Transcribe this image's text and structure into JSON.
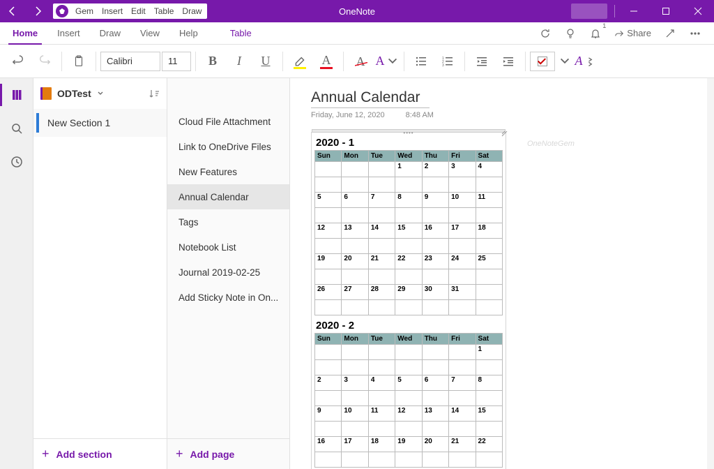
{
  "title": "OneNote",
  "quick_access": {
    "items": [
      "Gem",
      "Insert",
      "Edit",
      "Table",
      "Draw"
    ]
  },
  "ribbon": {
    "tabs": [
      "Home",
      "Insert",
      "Draw",
      "View",
      "Help",
      "Table"
    ],
    "active_tab": "Home",
    "font_name": "Calibri",
    "font_size": "11",
    "share_label": "Share",
    "notification_count": "1"
  },
  "notebook": {
    "name": "ODTest",
    "sections": [
      "New Section 1"
    ],
    "active_section": "New Section 1",
    "add_section_label": "Add section"
  },
  "pages": {
    "items": [
      "Cloud File Attachment",
      "Link to OneDrive Files",
      "New Features",
      "Annual Calendar",
      "Tags",
      "Notebook List",
      "Journal 2019-02-25",
      "Add Sticky Note in On..."
    ],
    "active_index": 3,
    "add_page_label": "Add page"
  },
  "page": {
    "title": "Annual Calendar",
    "date": "Friday, June 12, 2020",
    "time": "8:48 AM"
  },
  "watermark": "OneNoteGem",
  "calendar": {
    "day_headers": [
      "Sun",
      "Mon",
      "Tue",
      "Wed",
      "Thu",
      "Fri",
      "Sat"
    ],
    "months": [
      {
        "label": "2020 - 1",
        "weeks": [
          [
            "",
            "",
            "",
            "1",
            "2",
            "3",
            "4"
          ],
          [
            "5",
            "6",
            "7",
            "8",
            "9",
            "10",
            "11"
          ],
          [
            "12",
            "13",
            "14",
            "15",
            "16",
            "17",
            "18"
          ],
          [
            "19",
            "20",
            "21",
            "22",
            "23",
            "24",
            "25"
          ],
          [
            "26",
            "27",
            "28",
            "29",
            "30",
            "31",
            ""
          ]
        ]
      },
      {
        "label": "2020 - 2",
        "weeks": [
          [
            "",
            "",
            "",
            "",
            "",
            "",
            "1"
          ],
          [
            "2",
            "3",
            "4",
            "5",
            "6",
            "7",
            "8"
          ],
          [
            "9",
            "10",
            "11",
            "12",
            "13",
            "14",
            "15"
          ],
          [
            "16",
            "17",
            "18",
            "19",
            "20",
            "21",
            "22"
          ]
        ]
      }
    ]
  }
}
